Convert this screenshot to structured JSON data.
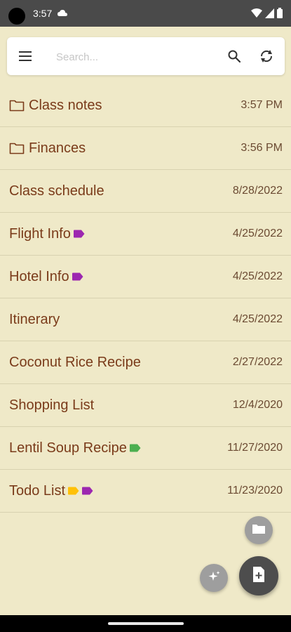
{
  "status_bar": {
    "time": "3:57"
  },
  "search": {
    "placeholder": "Search..."
  },
  "notes": [
    {
      "title": "Class notes",
      "date": "3:57 PM",
      "folder": true,
      "tags": []
    },
    {
      "title": "Finances",
      "date": "3:56 PM",
      "folder": true,
      "tags": []
    },
    {
      "title": "Class schedule",
      "date": "8/28/2022",
      "folder": false,
      "tags": []
    },
    {
      "title": "Flight Info",
      "date": "4/25/2022",
      "folder": false,
      "tags": [
        "#9c27b0"
      ]
    },
    {
      "title": "Hotel Info",
      "date": "4/25/2022",
      "folder": false,
      "tags": [
        "#9c27b0"
      ]
    },
    {
      "title": "Itinerary",
      "date": "4/25/2022",
      "folder": false,
      "tags": []
    },
    {
      "title": "Coconut Rice Recipe",
      "date": "2/27/2022",
      "folder": false,
      "tags": []
    },
    {
      "title": "Shopping List",
      "date": "12/4/2020",
      "folder": false,
      "tags": []
    },
    {
      "title": "Lentil Soup Recipe",
      "date": "11/27/2020",
      "folder": false,
      "tags": [
        "#4caf50"
      ]
    },
    {
      "title": "Todo List",
      "date": "11/23/2020",
      "folder": false,
      "tags": [
        "#ffc107",
        "#9c27b0"
      ]
    }
  ],
  "colors": {
    "background": "#efe9c8",
    "title_text": "#7a3b1a",
    "status_bar": "#4a4a4a"
  },
  "icons": {
    "menu": "hamburger-menu-icon",
    "search": "search-icon",
    "sync": "sync-icon",
    "folder": "folder-icon",
    "tag": "tag-icon",
    "new_folder": "folder-icon",
    "ai": "sparkle-icon",
    "new_note": "new-note-icon"
  }
}
